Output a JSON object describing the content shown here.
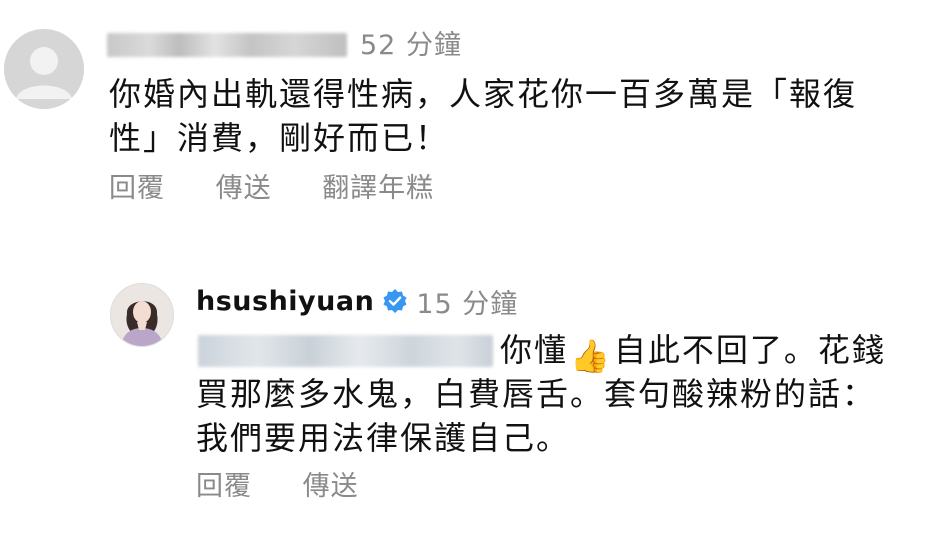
{
  "comment": {
    "time": "52 分鐘",
    "text": "你婚內出軌還得性病，人家花你一百多萬是「報復性」消費，剛好而已！",
    "actions": {
      "reply": "回覆",
      "send": "傳送",
      "translate": "翻譯年糕"
    }
  },
  "reply": {
    "username": "hsushiyuan",
    "verified_icon": "verified-badge-icon",
    "time": "15 分鐘",
    "line1_text": "你懂",
    "thumb": "👍",
    "line1_rest": "自此不回了。花錢",
    "line2": "買那麼多水鬼，白費唇舌。套句酸辣粉的話：",
    "line3": "我們要用法律保護自己。",
    "actions": {
      "reply": "回覆",
      "send": "傳送"
    }
  },
  "colors": {
    "meta_gray": "#8a8a8a",
    "verified_blue": "#3897f0",
    "text": "#111111"
  }
}
